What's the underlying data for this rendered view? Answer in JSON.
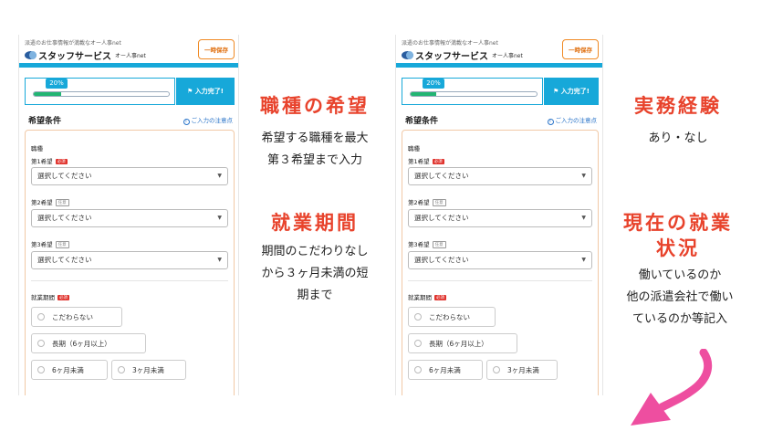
{
  "header": {
    "tagline": "派遣のお仕事情報が満載なオー人事net",
    "brand": "スタッフサービス",
    "brand_sub": "オー人事net",
    "save_label": "一時保存"
  },
  "progress": {
    "percent_label": "20%",
    "value": 0.2,
    "complete_label": "入力完了!"
  },
  "section": {
    "title": "希望条件",
    "notice": "ご入力の注意点"
  },
  "form": {
    "job_label": "職種",
    "required_badge": "必須",
    "optional_badge": "任意",
    "wish1_label": "第1希望",
    "wish2_label": "第2希望",
    "wish3_label": "第3希望",
    "select_placeholder": "選択してください",
    "period_label": "就業期間",
    "period_options": [
      "こだわらない",
      "長期（6ヶ月以上）",
      "6ヶ月未満",
      "3ヶ月未満"
    ]
  },
  "annotations": {
    "job_heading": "職種の希望",
    "job_body1": "希望する職種を最大",
    "job_body2": "第３希望まで入力",
    "period_heading": "就業期間",
    "period_body1": "期間のこだわりなし",
    "period_body2": "から３ヶ月未満の短",
    "period_body3": "期まで",
    "exp_heading": "実務経験",
    "exp_body": "あり・なし",
    "status_heading1": "現在の就業",
    "status_heading2": "状況",
    "status_body1": "働いているのか",
    "status_body2": "他の派遣会社で働い",
    "status_body3": "ているのか等記入"
  },
  "colors": {
    "accent": "#17a8d9",
    "heading_red": "#e8432c",
    "arrow_pink": "#ee4ea0",
    "progress_green": "#22b573"
  }
}
